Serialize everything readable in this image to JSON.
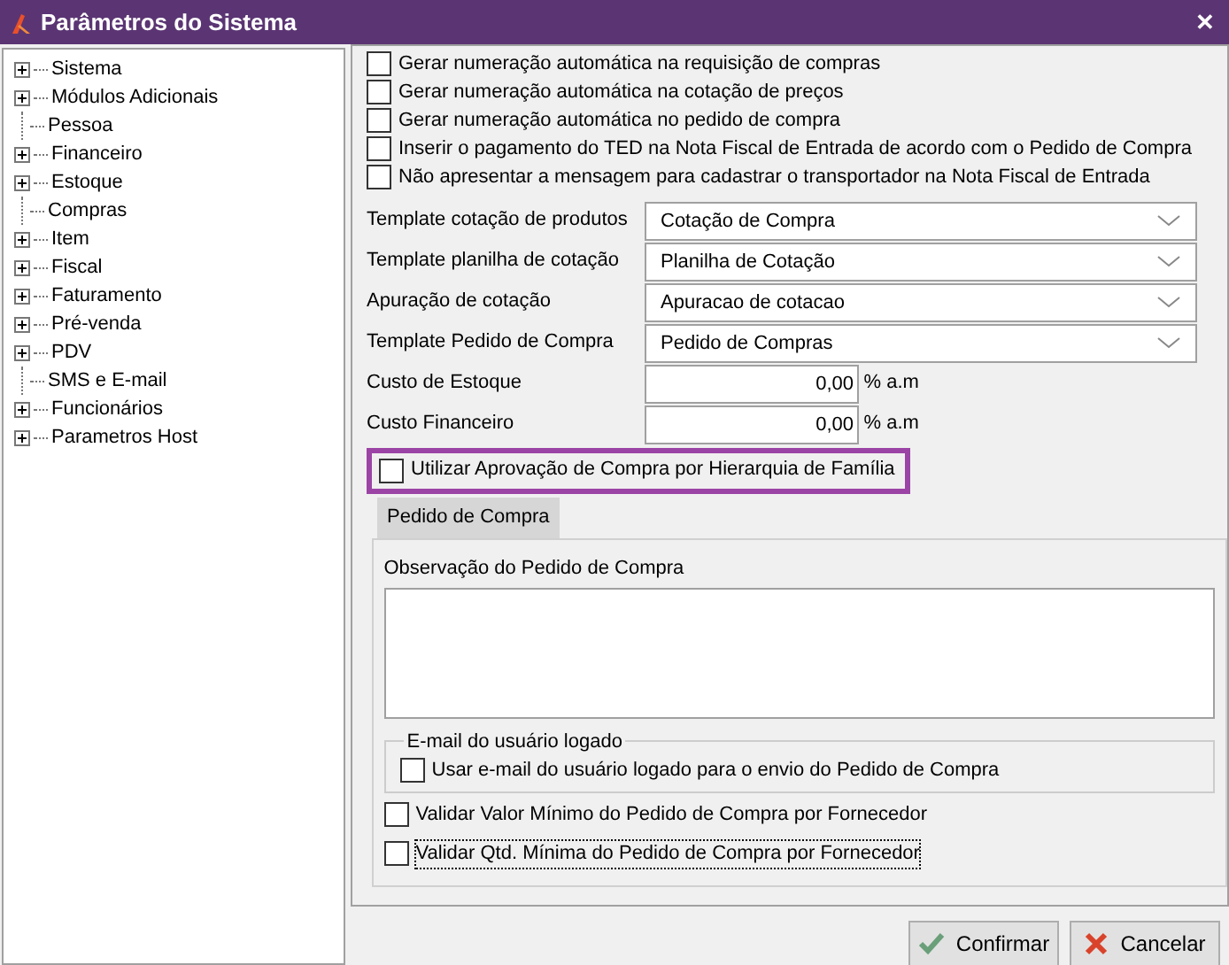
{
  "window": {
    "title": "Parâmetros do Sistema",
    "close": "✕"
  },
  "tree": [
    {
      "label": "Sistema",
      "expandable": true
    },
    {
      "label": "Módulos Adicionais",
      "expandable": true
    },
    {
      "label": "Pessoa",
      "expandable": false
    },
    {
      "label": "Financeiro",
      "expandable": true
    },
    {
      "label": "Estoque",
      "expandable": true
    },
    {
      "label": "Compras",
      "expandable": false
    },
    {
      "label": "Item",
      "expandable": true
    },
    {
      "label": "Fiscal",
      "expandable": true
    },
    {
      "label": "Faturamento",
      "expandable": true
    },
    {
      "label": "Pré-venda",
      "expandable": true
    },
    {
      "label": "PDV",
      "expandable": true
    },
    {
      "label": "SMS e E-mail",
      "expandable": false
    },
    {
      "label": "Funcionários",
      "expandable": true
    },
    {
      "label": "Parametros Host",
      "expandable": true
    }
  ],
  "top_checkboxes": [
    {
      "label": "Gerar numeração automática na requisição de compras",
      "checked": false
    },
    {
      "label": "Gerar numeração automática na cotação de preços",
      "checked": false
    },
    {
      "label": "Gerar numeração automática no pedido de compra",
      "checked": false
    },
    {
      "label": "Inserir o pagamento do TED na Nota Fiscal de Entrada de acordo com o Pedido de Compra",
      "checked": false
    },
    {
      "label": "Não apresentar a mensagem para cadastrar o transportador na Nota Fiscal de Entrada",
      "checked": false
    }
  ],
  "fields": [
    {
      "kind": "select",
      "label": "Template cotação de produtos",
      "value": "Cotação  de Compra"
    },
    {
      "kind": "select",
      "label": "Template planilha de cotação",
      "value": "Planilha de Cotação"
    },
    {
      "kind": "select",
      "label": "Apuração de cotação",
      "value": "Apuracao de cotacao"
    },
    {
      "kind": "select",
      "label": "Template Pedido de Compra",
      "value": "Pedido de Compras"
    },
    {
      "kind": "number",
      "label": "Custo de Estoque",
      "value": "0,00",
      "unit": "% a.m"
    },
    {
      "kind": "number",
      "label": "Custo Financeiro",
      "value": "0,00",
      "unit": "% a.m"
    }
  ],
  "hierarchy_checkbox": {
    "label": "Utilizar Aprovação de Compra por Hierarquia de Família",
    "checked": false,
    "highlighted": true
  },
  "tabs": [
    {
      "label": "Pedido de Compra",
      "selected": true
    }
  ],
  "observation": {
    "label": "Observação do Pedido de Compra"
  },
  "email_group": {
    "title": "E-mail do usuário logado",
    "checkbox": {
      "label": "Usar e-mail do usuário logado para o envio do Pedido de Compra",
      "checked": false
    }
  },
  "bottom_checkboxes": [
    {
      "label": "Validar Valor Mínimo do Pedido de Compra por Fornecedor",
      "checked": false,
      "focused": false
    },
    {
      "label": "Validar Qtd. Mínima do Pedido de Compra por Fornecedor",
      "checked": false,
      "focused": true
    }
  ],
  "buttons": [
    {
      "kind": "confirm",
      "label": "Confirmar"
    },
    {
      "kind": "cancel",
      "label": "Cancelar"
    }
  ]
}
